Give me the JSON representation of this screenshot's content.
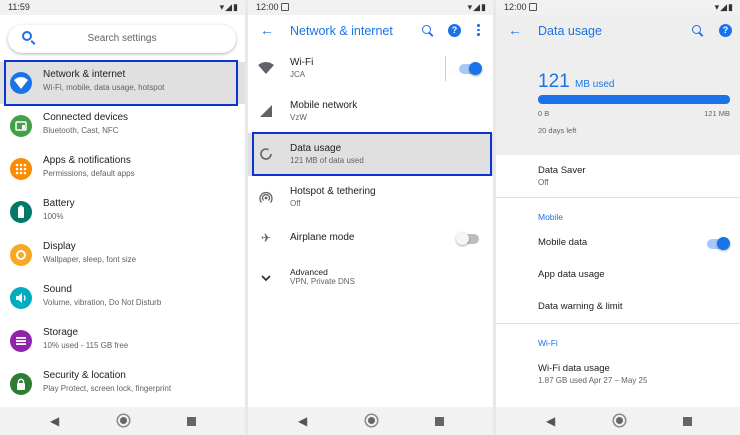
{
  "panel1": {
    "status_time": "11:59",
    "search_placeholder": "Search settings",
    "items": [
      {
        "title": "Network & internet",
        "subtitle": "Wi-Fi, mobile, data usage, hotspot",
        "icon": "wifi-icon",
        "color": "#1a73e8"
      },
      {
        "title": "Connected devices",
        "subtitle": "Bluetooth, Cast, NFC",
        "icon": "devices-icon",
        "color": "#43a047"
      },
      {
        "title": "Apps & notifications",
        "subtitle": "Permissions, default apps",
        "icon": "apps-icon",
        "color": "#fb8c00"
      },
      {
        "title": "Battery",
        "subtitle": "100%",
        "icon": "battery-icon",
        "color": "#00796b"
      },
      {
        "title": "Display",
        "subtitle": "Wallpaper, sleep, font size",
        "icon": "brightness-icon",
        "color": "#f9a825"
      },
      {
        "title": "Sound",
        "subtitle": "Volume, vibration, Do Not Disturb",
        "icon": "volume-icon",
        "color": "#00acc1"
      },
      {
        "title": "Storage",
        "subtitle": "10% used - 115 GB free",
        "icon": "storage-icon",
        "color": "#8e24aa"
      },
      {
        "title": "Security & location",
        "subtitle": "Play Protect, screen lock, fingerprint",
        "icon": "lock-icon",
        "color": "#2e7d32"
      }
    ]
  },
  "panel2": {
    "status_time": "12:00",
    "title": "Network & internet",
    "items": [
      {
        "title": "Wi-Fi",
        "subtitle": "JCA",
        "icon": "wifi-icon"
      },
      {
        "title": "Mobile network",
        "subtitle": "VzW",
        "icon": "signal-icon"
      },
      {
        "title": "Data usage",
        "subtitle": "121 MB of data used",
        "icon": "data-usage-icon"
      },
      {
        "title": "Hotspot & tethering",
        "subtitle": "Off",
        "icon": "hotspot-icon"
      },
      {
        "title": "Airplane mode",
        "subtitle": "",
        "icon": "airplane-icon"
      },
      {
        "title": "Advanced",
        "subtitle": "VPN, Private DNS",
        "icon": "chevron-down-icon"
      }
    ]
  },
  "panel3": {
    "status_time": "12:00",
    "title": "Data usage",
    "usage_value": "121",
    "usage_unit": "MB used",
    "usage_fraction": 1.0,
    "bar_min": "0 B",
    "bar_max": "121 MB",
    "days_left": "20 days left",
    "data_saver_title": "Data Saver",
    "data_saver_sub": "Off",
    "mobile_header": "Mobile",
    "mobile_data": "Mobile data",
    "app_data_usage": "App data usage",
    "data_warning": "Data warning & limit",
    "wifi_header": "Wi-Fi",
    "wifi_data_title": "Wi-Fi data usage",
    "wifi_data_sub": "1.87 GB used Apr 27 – May 25"
  },
  "colors": {
    "accent": "#1a73e8",
    "highlight": "#0a34d6"
  }
}
